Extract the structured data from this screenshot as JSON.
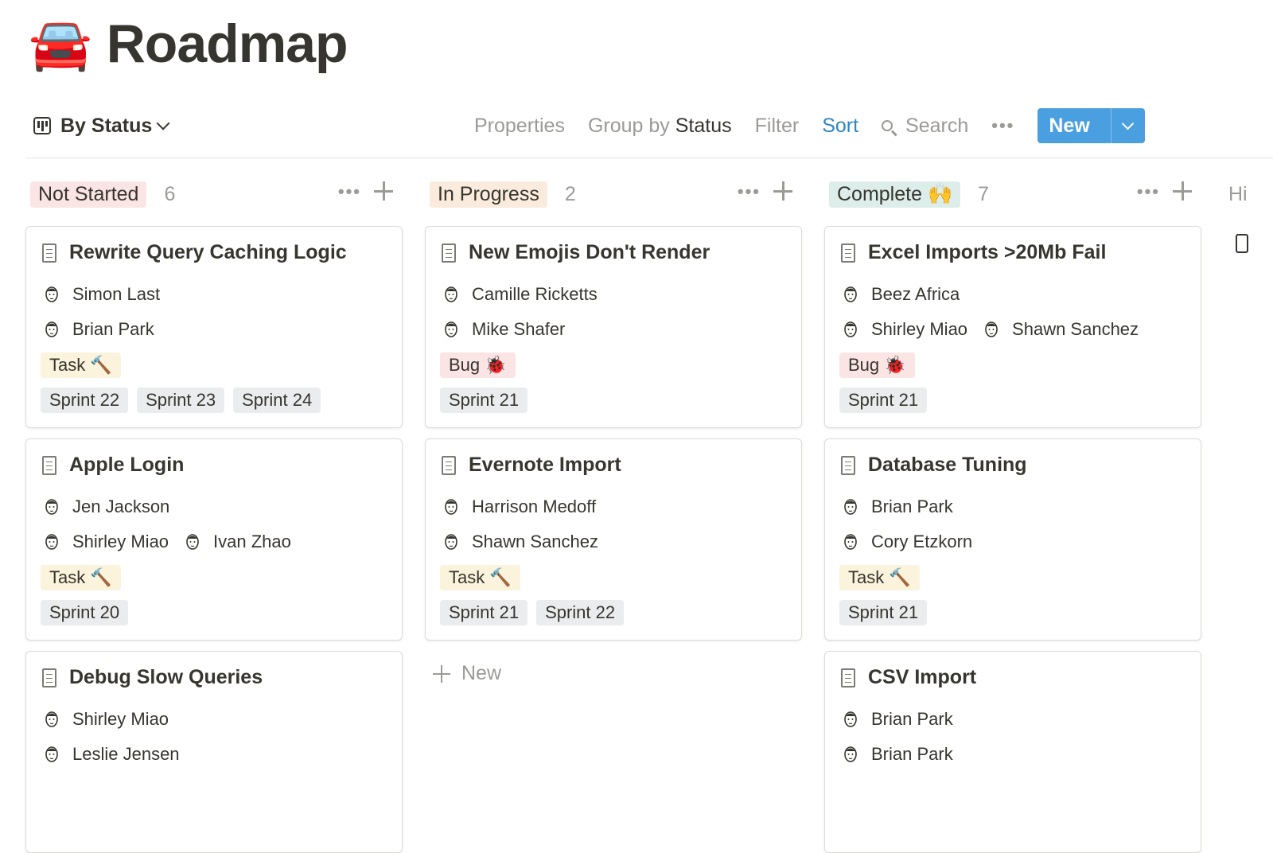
{
  "page": {
    "emoji": "🚘",
    "title": "Roadmap"
  },
  "toolbar": {
    "view_label": "By Status",
    "properties": "Properties",
    "group_by_prefix": "Group by",
    "group_by_value": "Status",
    "filter": "Filter",
    "sort": "Sort",
    "search": "Search",
    "more": "•••",
    "new": "New"
  },
  "colors": {
    "accent": "#4a9fe0",
    "sort_active": "#2e86c1"
  },
  "columns": [
    {
      "name": "Not Started",
      "count": "6",
      "color": "#fbe4e4",
      "cards": [
        {
          "title": "Rewrite Query Caching Logic",
          "people": [
            [
              "Simon Last"
            ],
            [
              "Brian Park"
            ]
          ],
          "type": "Task 🔨",
          "sprints": [
            "Sprint 22",
            "Sprint 23",
            "Sprint 24"
          ]
        },
        {
          "title": "Apple Login",
          "people": [
            [
              "Jen Jackson"
            ],
            [
              "Shirley Miao",
              "Ivan Zhao"
            ]
          ],
          "type": "Task 🔨",
          "sprints": [
            "Sprint 20"
          ]
        },
        {
          "title": "Debug Slow Queries",
          "people": [
            [
              "Shirley Miao"
            ],
            [
              "Leslie Jensen"
            ]
          ],
          "type": "",
          "sprints": []
        }
      ]
    },
    {
      "name": "In Progress",
      "count": "2",
      "color": "#faebdd",
      "cards": [
        {
          "title": "New Emojis Don't Render",
          "people": [
            [
              "Camille Ricketts"
            ],
            [
              "Mike Shafer"
            ]
          ],
          "type": "Bug 🐞",
          "sprints": [
            "Sprint 21"
          ]
        },
        {
          "title": "Evernote Import",
          "people": [
            [
              "Harrison Medoff"
            ],
            [
              "Shawn Sanchez"
            ]
          ],
          "type": "Task 🔨",
          "sprints": [
            "Sprint 21",
            "Sprint 22"
          ]
        }
      ],
      "add_label": "New"
    },
    {
      "name": "Complete 🙌",
      "count": "7",
      "color": "#ddedea",
      "cards": [
        {
          "title": "Excel Imports >20Mb Fail",
          "people": [
            [
              "Beez Africa"
            ],
            [
              "Shirley Miao",
              "Shawn Sanchez"
            ]
          ],
          "type": "Bug 🐞",
          "sprints": [
            "Sprint 21"
          ]
        },
        {
          "title": "Database Tuning",
          "people": [
            [
              "Brian Park"
            ],
            [
              "Cory Etzkorn"
            ]
          ],
          "type": "Task 🔨",
          "sprints": [
            "Sprint 21"
          ]
        },
        {
          "title": "CSV Import",
          "people": [
            [
              "Brian Park"
            ],
            [
              "Brian Park"
            ]
          ],
          "type": "",
          "sprints": []
        }
      ]
    }
  ],
  "tag_colors": {
    "Task 🔨": "#fbf3db",
    "Bug 🐞": "#fbe4e4",
    "sprint": "#ebeced"
  },
  "hidden_label": "Hi"
}
